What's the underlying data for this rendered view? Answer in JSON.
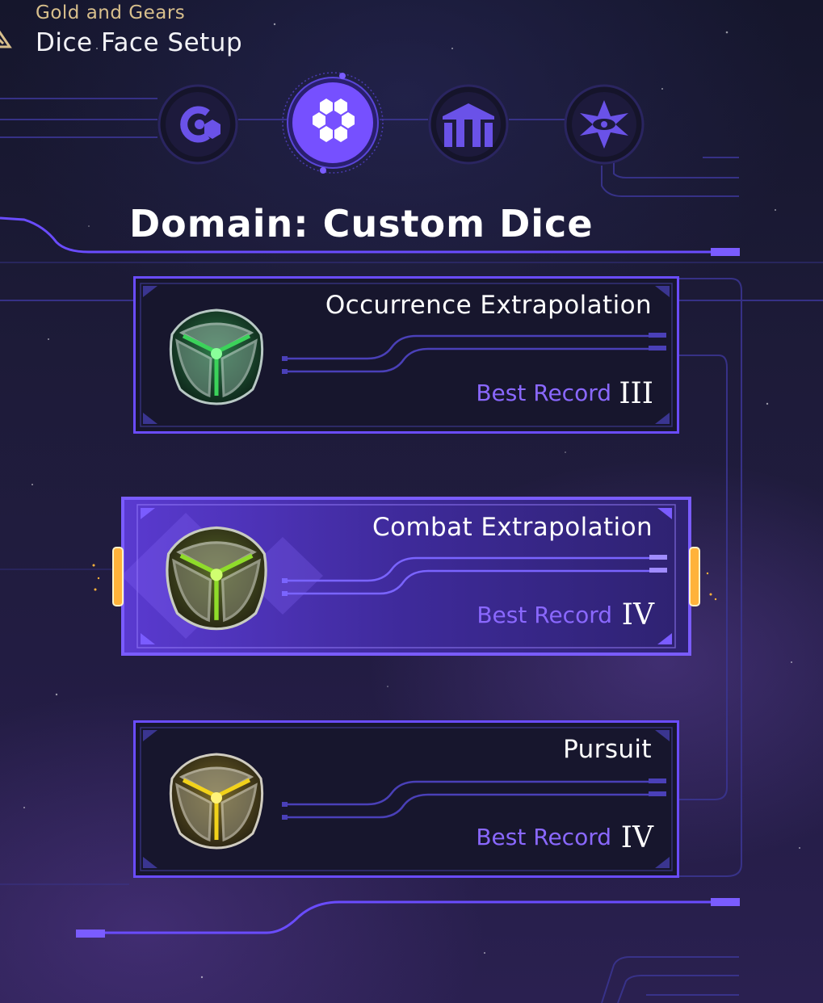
{
  "header": {
    "subtitle": "Gold and Gears",
    "title": "Dice Face Setup"
  },
  "tabs": [
    {
      "icon": "loop-icon",
      "selected": false
    },
    {
      "icon": "hexagon-cluster-icon",
      "selected": true
    },
    {
      "icon": "columns-icon",
      "selected": false
    },
    {
      "icon": "star-eye-icon",
      "selected": false
    }
  ],
  "domain_title": "Domain: Custom Dice",
  "cards": [
    {
      "name": "Occurrence Extrapolation",
      "record_label": "Best Record",
      "record_value": "III",
      "dice_color": "#3bd35a",
      "selected": false
    },
    {
      "name": "Combat Extrapolation",
      "record_label": "Best Record",
      "record_value": "IV",
      "dice_color": "#8fdc2a",
      "selected": true
    },
    {
      "name": "Pursuit",
      "record_label": "Best Record",
      "record_value": "IV",
      "dice_color": "#f2d21a",
      "selected": false
    }
  ],
  "colors": {
    "accent": "#7a4dff",
    "gold": "#d8bf8c",
    "record_label": "#8a68ff",
    "selected_card": "#4a2fb0",
    "glow_orange": "#ffb23a"
  }
}
